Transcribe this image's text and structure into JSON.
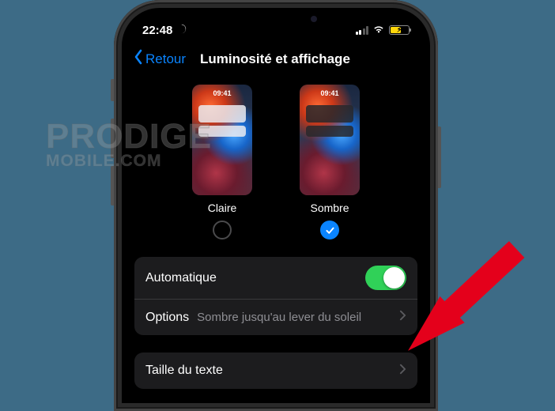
{
  "status": {
    "time": "22:48",
    "battery_percent": 55
  },
  "nav": {
    "back_label": "Retour",
    "title": "Luminosité et affichage"
  },
  "appearance": {
    "preview_time": "09:41",
    "light": {
      "label": "Claire",
      "selected": false
    },
    "dark": {
      "label": "Sombre",
      "selected": true
    }
  },
  "automatic": {
    "label": "Automatique",
    "enabled": true
  },
  "options_row": {
    "label": "Options",
    "value": "Sombre jusqu'au lever du soleil"
  },
  "text_size_row": {
    "label": "Taille du texte"
  },
  "watermark": {
    "line1": "PRODIGE",
    "line2": "MOBILE.COM"
  }
}
